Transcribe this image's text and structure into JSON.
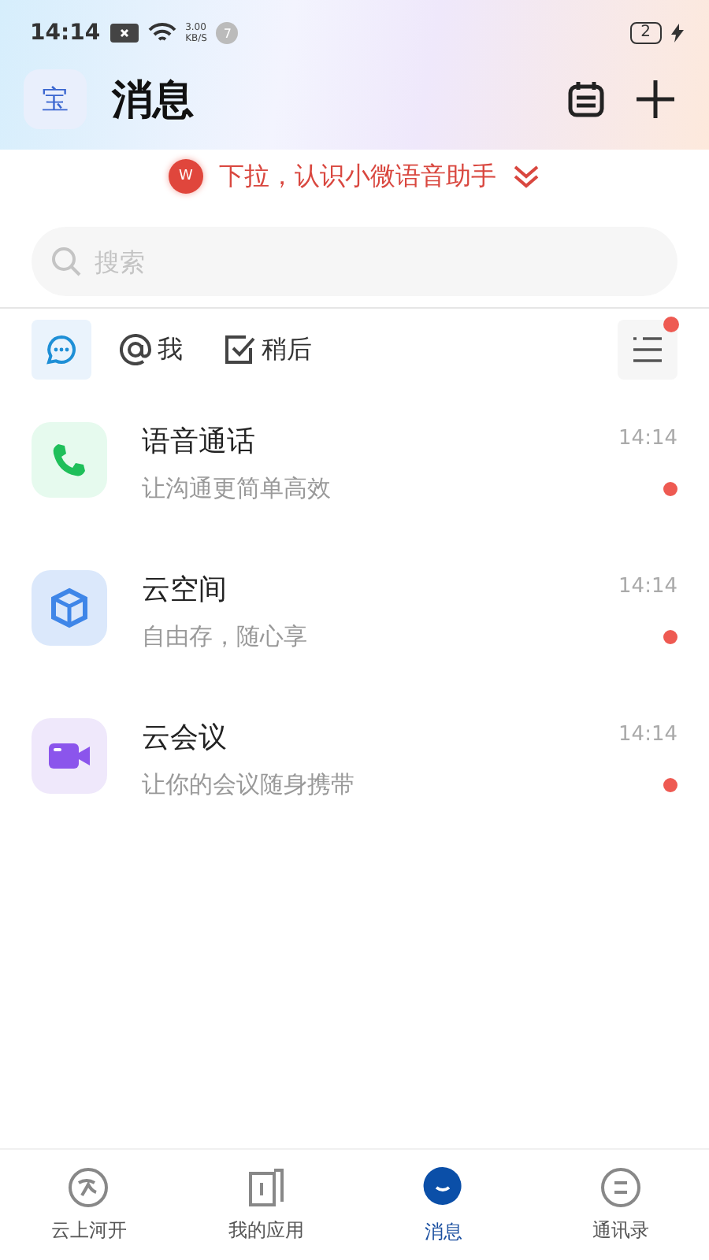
{
  "status_bar": {
    "time": "14:14",
    "speed": "3.00",
    "speed_unit": "KB/S",
    "notification_count": "7",
    "battery": "2"
  },
  "header": {
    "avatar": "宝",
    "title": "消息"
  },
  "banner": {
    "badge": "W",
    "text": "下拉，认识小微语音助手"
  },
  "search": {
    "placeholder": "搜索"
  },
  "filters": [
    {
      "kind": "chat",
      "selected": true
    },
    {
      "kind": "at",
      "label": "我",
      "selected": false
    },
    {
      "kind": "check",
      "label": "稍后",
      "selected": false
    }
  ],
  "filter_menu": {
    "badge": true
  },
  "conversations": [
    {
      "kind": "phone",
      "title": "语音通话",
      "subtitle": "让沟通更简单高效",
      "time": "14:14",
      "unread": true
    },
    {
      "kind": "cube",
      "title": "云空间",
      "subtitle": "自由存，随心享",
      "time": "14:14",
      "unread": true
    },
    {
      "kind": "video",
      "title": "云会议",
      "subtitle": "让你的会议随身携带",
      "time": "14:14",
      "unread": true
    }
  ],
  "tab_bar": [
    {
      "kind": "home",
      "label": "云上河开",
      "selected": false
    },
    {
      "kind": "apps",
      "label": "我的应用",
      "selected": false
    },
    {
      "kind": "chat",
      "label": "消息",
      "selected": true
    },
    {
      "kind": "contacts",
      "label": "通讯录",
      "selected": false
    }
  ]
}
